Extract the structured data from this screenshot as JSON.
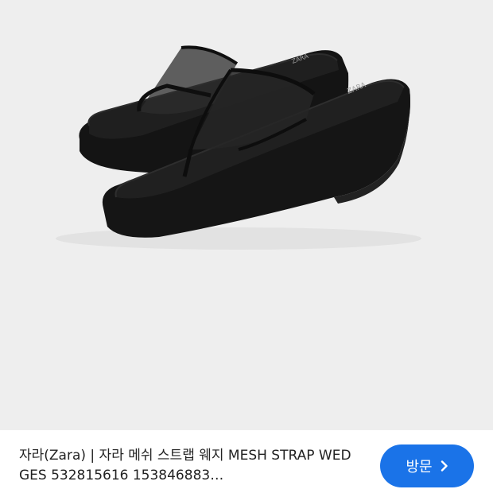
{
  "product": {
    "title": "자라(Zara) | 자라 메쉬 스트랩 웨지 MESH STRAP WEDGES 532815616 153846883…"
  },
  "actions": {
    "visit_label": "방문",
    "visit_icon": "chevron-right-icon"
  },
  "colors": {
    "image_bg": "#eeeeee",
    "button_bg": "#1a73e8",
    "button_text": "#ffffff",
    "title_text": "#222222"
  }
}
